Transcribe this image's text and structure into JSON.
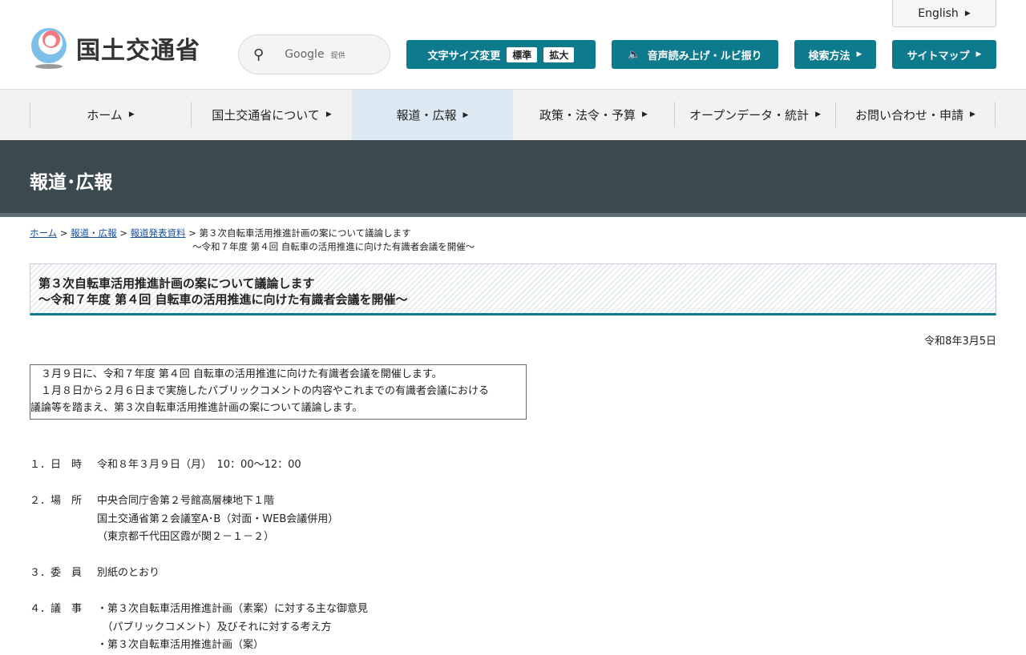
{
  "header": {
    "logo_text": "国土交通省",
    "search_label": "Google",
    "search_sub": "提供",
    "english": "English",
    "font_size_label": "文字サイズ変更",
    "font_std": "標準",
    "font_large": "拡大",
    "speech": "音声読み上げ・ルビ振り",
    "search_method": "検索方法",
    "sitemap": "サイトマップ"
  },
  "nav": [
    "ホーム",
    "国土交通省について",
    "報道・広報",
    "政策・法令・予算",
    "オープンデータ・統計",
    "お問い合わせ・申請"
  ],
  "banner": "報道･広報",
  "breadcrumb": {
    "home": "ホーム",
    "press": "報道・広報",
    "release": "報道発表資料",
    "current1": "第３次自転車活用推進計画の案について議論します",
    "current2": "～令和７年度 第４回 自転車の活用推進に向けた有識者会議を開催～"
  },
  "title": {
    "line1": "第３次自転車活用推進計画の案について議論します",
    "line2": "～令和７年度 第４回 自転車の活用推進に向けた有識者会議を開催～"
  },
  "date": "令和8年3月5日",
  "summary": [
    "　３月９日に、令和７年度 第４回 自転車の活用推進に向けた有識者会議を開催します。",
    "　１月８日から２月６日まで実施したパブリックコメントの内容やこれまでの有識者会議における",
    "議論等を踏まえ、第３次自転車活用推進計画の案について議論します。"
  ],
  "items": [
    {
      "key": "１．日　時",
      "lines": [
        "令和８年３月９日（月）　10：00～12：00"
      ]
    },
    {
      "key": "２．場　所",
      "lines": [
        "中央合同庁舎第２号館高層棟地下１階",
        "国土交通省第２会議室A･B（対面・WEB会議併用）",
        "（東京都千代田区霞が関２－１－２）"
      ]
    },
    {
      "key": "３．委　員",
      "lines": [
        "別紙のとおり"
      ]
    },
    {
      "key": "４．議　事",
      "lines": [
        "・第３次自転車活用推進計画（素案）に対する主な御意見",
        "　（パブリックコメント）及びそれに対する考え方",
        "・第３次自転車活用推進計画（案）"
      ]
    }
  ]
}
